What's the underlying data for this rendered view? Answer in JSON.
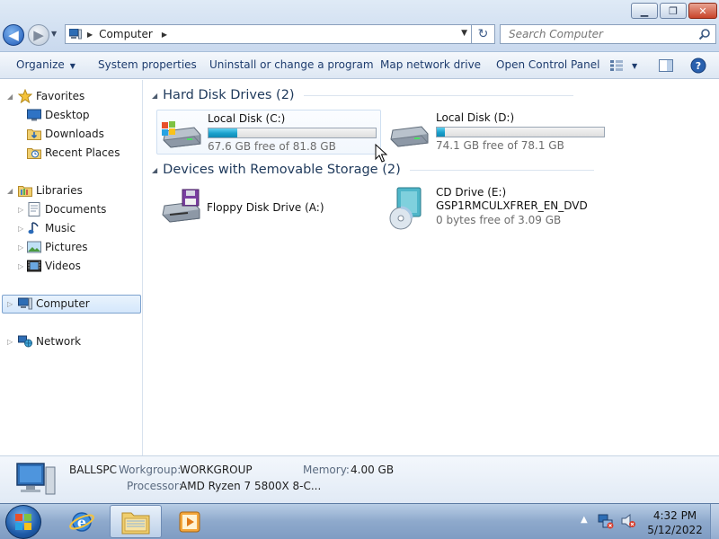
{
  "window": {
    "controls": {
      "minimize": "minimize-icon",
      "maximize": "maximize-icon",
      "close": "close-icon"
    }
  },
  "address": {
    "location_icon": "computer-icon",
    "breadcrumb": "Computer",
    "search_placeholder": "Search Computer"
  },
  "toolbar": {
    "organize": "Organize",
    "system_properties": "System properties",
    "uninstall": "Uninstall or change a program",
    "map_drive": "Map network drive",
    "control_panel": "Open Control Panel",
    "icons": [
      "change-view-icon",
      "preview-pane-icon",
      "help-icon"
    ]
  },
  "sidebar": {
    "favorites": {
      "label": "Favorites",
      "items": [
        {
          "label": "Desktop",
          "icon": "desktop-icon"
        },
        {
          "label": "Downloads",
          "icon": "downloads-folder-icon"
        },
        {
          "label": "Recent Places",
          "icon": "recent-places-icon"
        }
      ]
    },
    "libraries": {
      "label": "Libraries",
      "items": [
        {
          "label": "Documents",
          "icon": "documents-icon"
        },
        {
          "label": "Music",
          "icon": "music-icon"
        },
        {
          "label": "Pictures",
          "icon": "pictures-icon"
        },
        {
          "label": "Videos",
          "icon": "videos-icon"
        }
      ]
    },
    "computer": {
      "label": "Computer",
      "selected": true
    },
    "network": {
      "label": "Network"
    }
  },
  "groups": {
    "hard_disks": {
      "title": "Hard Disk Drives (2)",
      "drives": [
        {
          "name": "Local Disk (C:)",
          "free_text": "67.6 GB free of 81.8 GB",
          "used_fraction": 0.17,
          "icon": "windows-drive-icon"
        },
        {
          "name": "Local Disk (D:)",
          "free_text": "74.1 GB free of 78.1 GB",
          "used_fraction": 0.05,
          "icon": "hard-drive-icon"
        }
      ]
    },
    "removable": {
      "title": "Devices with Removable Storage (2)",
      "devices": [
        {
          "name": "Floppy Disk Drive (A:)",
          "icon": "floppy-drive-icon"
        },
        {
          "name": "CD Drive (E:)",
          "label": "GSP1RMCULXFRER_EN_DVD",
          "free_text": "0 bytes free of 3.09 GB",
          "icon": "dvd-drive-icon"
        }
      ]
    }
  },
  "details": {
    "computer_name": "BALLSPC",
    "workgroup_label": "Workgroup:",
    "workgroup": "WORKGROUP",
    "memory_label": "Memory:",
    "memory": "4.00 GB",
    "processor_label": "Processor:",
    "processor": "AMD Ryzen 7 5800X 8-C..."
  },
  "taskbar": {
    "pinned": [
      "start-orb-icon",
      "internet-explorer-icon",
      "windows-explorer-icon",
      "media-player-icon"
    ],
    "tray": [
      "show-hidden-icons-icon",
      "network-icon",
      "volume-muted-icon"
    ],
    "time": "4:32 PM",
    "date": "5/12/2022"
  },
  "colors": {
    "accent": "#1e3c6e",
    "bar_fill": "#1aa0cc",
    "selection": "#d4e7fb"
  }
}
